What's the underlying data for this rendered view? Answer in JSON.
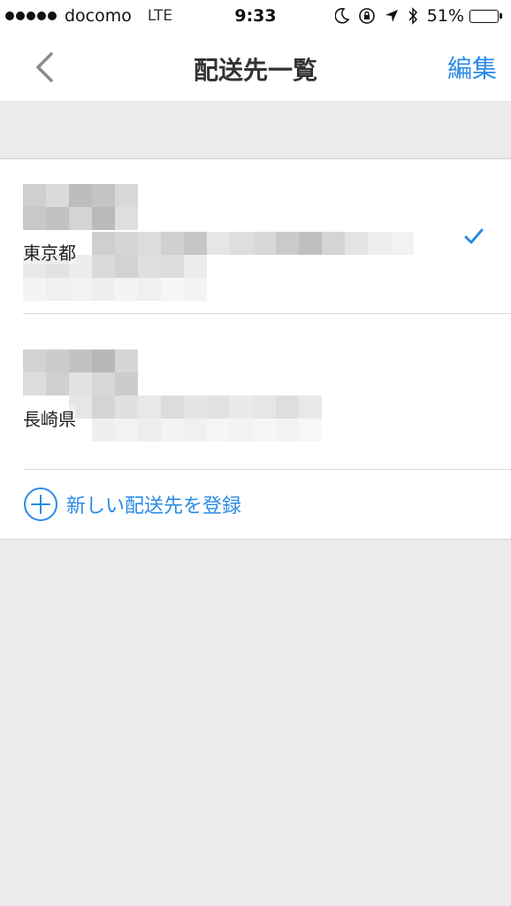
{
  "status_bar": {
    "carrier": "docomo",
    "network": "LTE",
    "time": "9:33",
    "battery_percent": "51%",
    "battery_level": 0.51
  },
  "nav": {
    "title": "配送先一覧",
    "edit_label": "編集"
  },
  "addresses": [
    {
      "prefecture": "東京都",
      "selected": true
    },
    {
      "prefecture": "長崎県",
      "selected": false
    }
  ],
  "add_address_label": "新しい配送先を登録",
  "colors": {
    "accent": "#2a8be6",
    "background": "#ebebeb",
    "surface": "#ffffff"
  },
  "icons": {
    "back": "chevron-left-icon",
    "check": "checkmark-icon",
    "add": "plus-circle-icon"
  }
}
